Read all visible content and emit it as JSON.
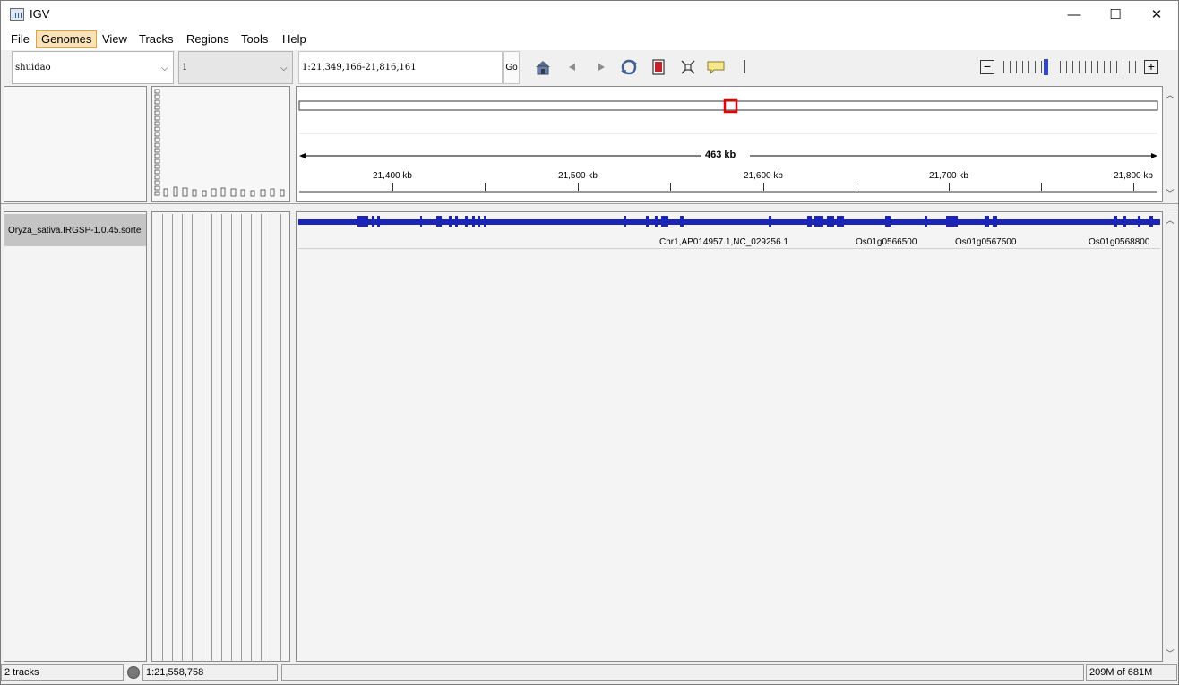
{
  "window": {
    "title": "IGV",
    "minimize_label": "—",
    "maximize_label": "☐",
    "close_label": "✕"
  },
  "menu": {
    "file": "File",
    "genomes": "Genomes",
    "view": "View",
    "tracks": "Tracks",
    "regions": "Regions",
    "tools": "Tools",
    "help": "Help"
  },
  "toolbar": {
    "genome": "shuidao",
    "chromosome": "1",
    "locus": "1:21,349,166-21,816,161",
    "go_label": "Go",
    "zoom_out": "−",
    "zoom_in": "+",
    "zoom_level_fraction": 0.32
  },
  "ruler": {
    "span_label": "463 kb",
    "ticks": [
      "21,400 kb",
      "21,500 kb",
      "21,600 kb",
      "21,700 kb",
      "21,800 kb"
    ]
  },
  "track": {
    "name": "Oryza_sativa.IRGSP-1.0.45.sorte",
    "gene_labels": [
      "Chr1,AP014957.1,NC_029256.1",
      "Os01g0566500",
      "Os01g0567500",
      "Os01g0568800"
    ]
  },
  "attribute_header_glyphs": "ꟷꟷꟷꟷꟷꟷꟷꟷꟷꟷ",
  "status": {
    "tracks": "2 tracks",
    "position": "1:21,558,758",
    "message": "",
    "memory": "209M of 681M"
  },
  "colors": {
    "feature": "#1b24b4",
    "region_box": "#e00000",
    "menu_active_bg": "#fbe3b9"
  }
}
